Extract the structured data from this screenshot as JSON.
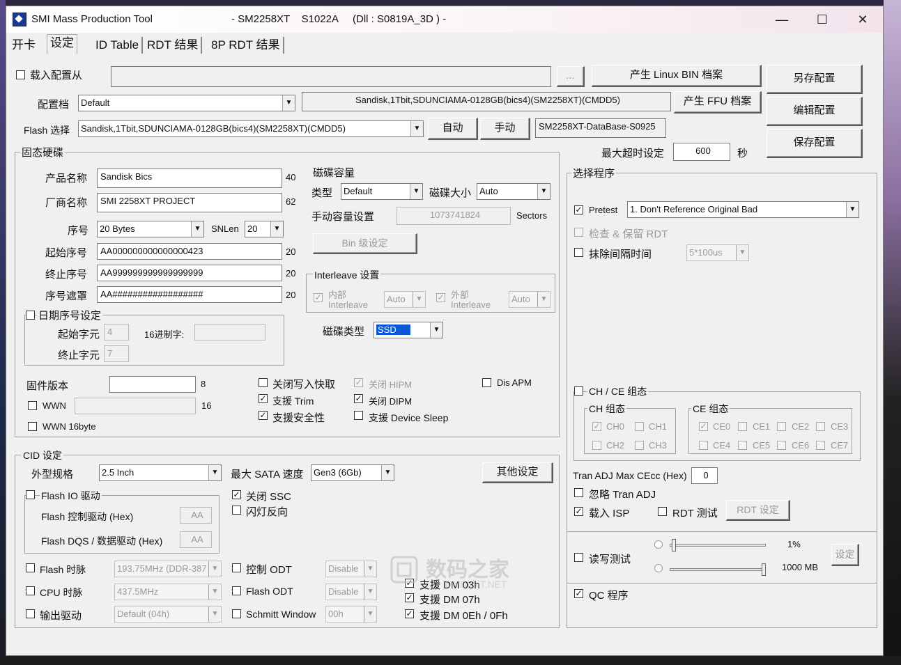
{
  "window": {
    "title": "SMI Mass Production Tool",
    "title_detail": "- SM2258XT    S1022A     (Dll : S0819A_3D ) -",
    "min": "—",
    "max": "☐",
    "close": "✕"
  },
  "tabs": [
    "开卡",
    "设定",
    "ID Table",
    "RDT 结果",
    "8P RDT 结果"
  ],
  "load_config": {
    "label": "载入配置从",
    "path": "",
    "browse": "..."
  },
  "buttons": {
    "linux_bin": "产生 Linux BIN 档案",
    "ffu": "产生 FFU 档案",
    "save_as": "另存配置",
    "edit": "编辑配置",
    "save": "保存配置",
    "auto": "自动",
    "manual": "手动",
    "bin_setting": "Bin 级设定",
    "other": "其他设定",
    "rdt_setting": "RDT 设定",
    "set": "设定"
  },
  "config": {
    "label": "配置档",
    "value": "Default"
  },
  "flash_info": "Sandisk,1Tbit,SDUNCIAMA-0128GB(bics4)(SM2258XT)(CMDD5)",
  "flash_select": {
    "label": "Flash 选择",
    "value": "Sandisk,1Tbit,SDUNCIAMA-0128GB(bics4)(SM2258XT)(CMDD5)"
  },
  "database": "SM2258XT-DataBase-S0925",
  "timeout": {
    "label": "最大超时设定",
    "value": "600",
    "unit": "秒"
  },
  "ssd": {
    "title": "固态硬碟",
    "product_label": "产品名称",
    "product": "Sandisk Bics",
    "product_len": "40",
    "vendor_label": "厂商名称",
    "vendor": "SMI 2258XT PROJECT",
    "vendor_len": "62",
    "serial_label": "序号",
    "serial": "20 Bytes",
    "snlen_label": "SNLen",
    "snlen": "20",
    "start_sn_label": "起始序号",
    "start_sn": "AA000000000000000423",
    "start_sn_len": "20",
    "end_sn_label": "终止序号",
    "end_sn": "AA999999999999999999",
    "end_sn_len": "20",
    "mask_label": "序号遮罩",
    "mask": "AA##################",
    "mask_len": "20",
    "date_label": "日期序号设定",
    "start_char_label": "起始字元",
    "start_char": "4",
    "hex_label": "16进制字:",
    "hex": "",
    "end_char_label": "终止字元",
    "end_char": "7",
    "fw_label": "固件版本",
    "fw": "",
    "fw_len": "8",
    "wwn_label": "WWN",
    "wwn": "",
    "wwn_len": "16",
    "wwn16_label": "WWN 16byte"
  },
  "capacity": {
    "title": "磁碟容量",
    "type_label": "类型",
    "type": "Default",
    "size_label": "磁碟大小",
    "size": "Auto",
    "manual_label": "手动容量设置",
    "manual": "1073741824",
    "unit": "Sectors"
  },
  "interleave": {
    "title": "Interleave 设置",
    "internal_1": "内部",
    "internal_2": "Interleave",
    "internal": "Auto",
    "external_1": "外部",
    "external_2": "Interleave",
    "external": "Auto"
  },
  "disk_type": {
    "label": "磁碟类型",
    "value": "SSD"
  },
  "features": {
    "write_cache": "关闭写入快取",
    "trim": "支援 Trim",
    "security": "支援安全性",
    "hipm": "关闭 HIPM",
    "dipm": "关闭 DIPM",
    "device_sleep": "支援 Device Sleep",
    "dis_apm": "Dis APM"
  },
  "program": {
    "title": "选择程序",
    "pretest_label": "Pretest",
    "pretest": "1. Don't Reference Original Bad",
    "check_rdt": "检查 & 保留 RDT",
    "erase_label": "抹除间隔时间",
    "erase": "5*100us"
  },
  "chce": {
    "title": "CH / CE 组态",
    "ch_title": "CH 组态",
    "ch": [
      "CH0",
      "CH1",
      "CH2",
      "CH3"
    ],
    "ce_title": "CE 组态",
    "ce": [
      "CE0",
      "CE1",
      "CE2",
      "CE3",
      "CE4",
      "CE5",
      "CE6",
      "CE7"
    ]
  },
  "tran_adj": {
    "label": "Tran ADJ Max CEcc (Hex)",
    "value": "0",
    "ignore": "忽略 Tran ADJ"
  },
  "isp": "载入 ISP",
  "rdt": "RDT 测试",
  "rw_test": {
    "label": "读写测试",
    "percent": "1%",
    "size": "1000 MB",
    "percent_level": 0.02,
    "size_level": 1.0
  },
  "qc": "QC 程序",
  "cid": {
    "title": "CID 设定",
    "form_label": "外型规格",
    "form": "2.5 Inch",
    "sata_label": "最大 SATA 速度",
    "sata": "Gen3 (6Gb)",
    "flash_io_label": "Flash IO 驱动",
    "flash_ctrl_label": "Flash 控制驱动 (Hex)",
    "flash_ctrl": "AA",
    "flash_dqs_label": "Flash DQS / 数据驱动 (Hex)",
    "flash_dqs": "AA",
    "ssc": "关闭 SSC",
    "led": "闪灯反向",
    "flash_clock_label": "Flash 时脉",
    "flash_clock": "193.75MHz (DDR-387",
    "cpu_clock_label": "CPU 时脉",
    "cpu_clock": "437.5MHz",
    "output_label": "输出驱动",
    "output": "Default (04h)",
    "ctrl_odt_label": "控制 ODT",
    "ctrl_odt": "Disable",
    "flash_odt_label": "Flash ODT",
    "flash_odt": "Disable",
    "schmitt_label": "Schmitt Window",
    "schmitt": "00h",
    "dm03": "支援 DM 03h",
    "dm07": "支援 DM 07h",
    "dm0e": "支援 DM 0Eh / 0Fh"
  },
  "watermark": {
    "line1": "数码之家",
    "line2": "MYDIGIT.NET"
  }
}
